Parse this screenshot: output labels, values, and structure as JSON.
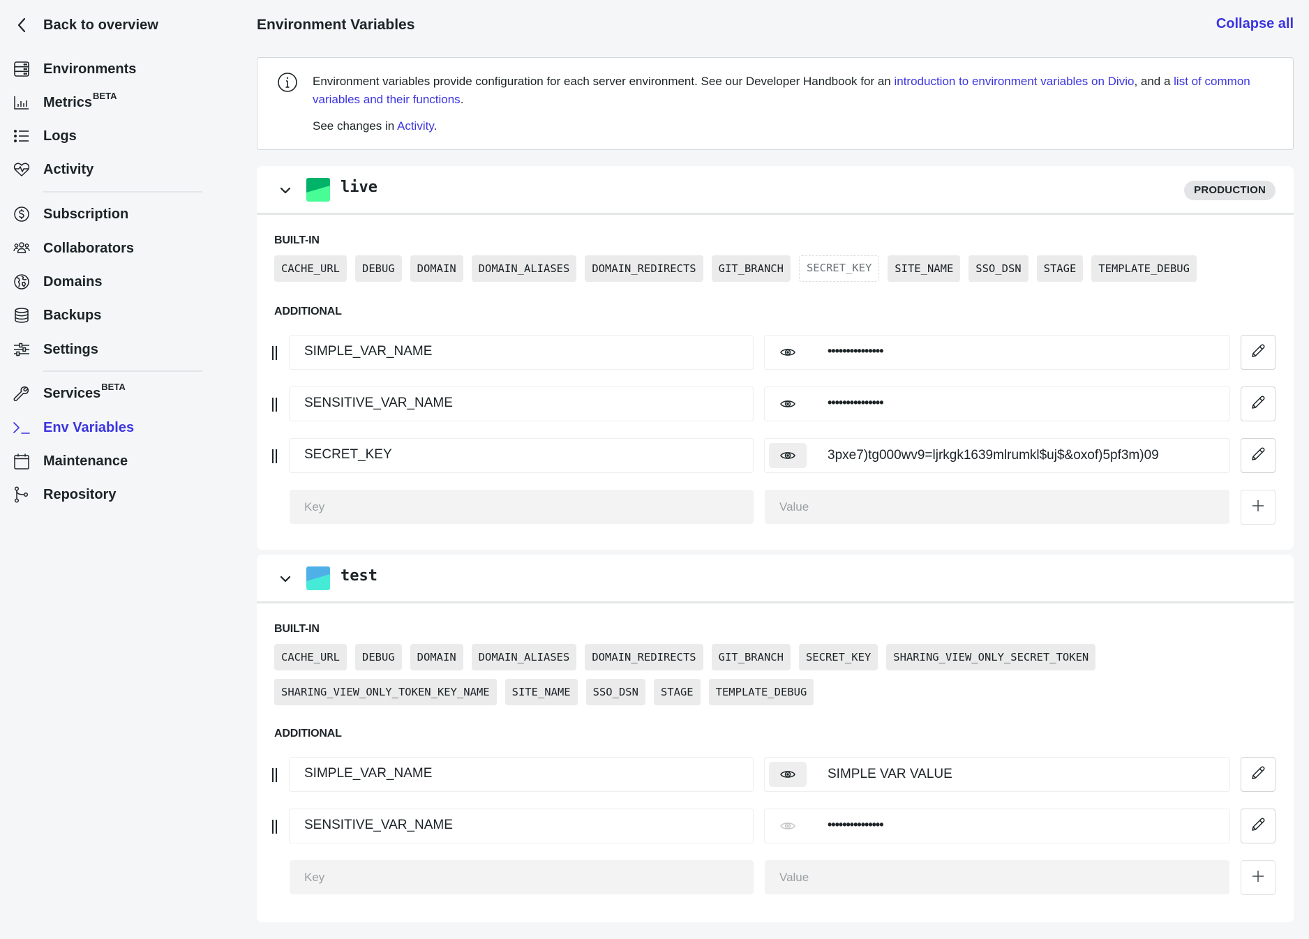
{
  "sidebar": {
    "back_label": "Back to overview",
    "items": [
      {
        "label": "Environments",
        "icon": "server-stack-icon"
      },
      {
        "label": "Metrics",
        "badge": "BETA",
        "icon": "bar-chart-icon"
      },
      {
        "label": "Logs",
        "icon": "list-icon"
      },
      {
        "label": "Activity",
        "icon": "heart-pulse-icon"
      },
      {
        "label": "Subscription",
        "icon": "dollar-circle-icon"
      },
      {
        "label": "Collaborators",
        "icon": "users-icon"
      },
      {
        "label": "Domains",
        "icon": "globe-icon"
      },
      {
        "label": "Backups",
        "icon": "database-icon"
      },
      {
        "label": "Settings",
        "icon": "sliders-icon"
      },
      {
        "label": "Services",
        "badge": "BETA",
        "icon": "wrench-icon"
      },
      {
        "label": "Env Variables",
        "icon": "terminal-icon",
        "active": true
      },
      {
        "label": "Maintenance",
        "icon": "calendar-icon"
      },
      {
        "label": "Repository",
        "icon": "git-branch-icon"
      }
    ]
  },
  "header": {
    "title": "Environment Variables",
    "collapse_all": "Collapse all"
  },
  "info": {
    "text_1": "Environment variables provide configuration for each server environment. See our Developer Handbook for an ",
    "link_1": "introduction to environment variables on Divio",
    "text_2": ", and a ",
    "link_2": "list of common variables and their functions",
    "text_3": ".",
    "text_4": "See changes in ",
    "link_3": "Activity",
    "text_5": "."
  },
  "colors": {
    "accent": "#3b35e0",
    "live_swatch_top": "#00b368",
    "live_swatch_bottom": "#48fc96",
    "test_swatch_top": "#4fb0e8",
    "test_swatch_bottom": "#46ebd8"
  },
  "environments": [
    {
      "name": "live",
      "badge": "PRODUCTION",
      "builtin_label": "BUILT-IN",
      "builtin": [
        "CACHE_URL",
        "DEBUG",
        "DOMAIN",
        "DOMAIN_ALIASES",
        "DOMAIN_REDIRECTS",
        "GIT_BRANCH",
        "SECRET_KEY",
        "SITE_NAME",
        "SSO_DSN",
        "STAGE",
        "TEMPLATE_DEBUG"
      ],
      "builtin_overridden": [
        "SECRET_KEY"
      ],
      "additional_label": "ADDITIONAL",
      "variables": [
        {
          "key": "SIMPLE_VAR_NAME",
          "value": "•••••••••••••••",
          "revealed": false
        },
        {
          "key": "SENSITIVE_VAR_NAME",
          "value": "•••••••••••••••",
          "revealed": false
        },
        {
          "key": "SECRET_KEY",
          "value": "3pxe7)tg000wv9=ljrkgk1639mlrumkl$uj$&oxof)5pf3m)09",
          "revealed": true
        }
      ],
      "new_key_placeholder": "Key",
      "new_value_placeholder": "Value"
    },
    {
      "name": "test",
      "badge": "",
      "builtin_label": "BUILT-IN",
      "builtin": [
        "CACHE_URL",
        "DEBUG",
        "DOMAIN",
        "DOMAIN_ALIASES",
        "DOMAIN_REDIRECTS",
        "GIT_BRANCH",
        "SECRET_KEY",
        "SHARING_VIEW_ONLY_SECRET_TOKEN",
        "SHARING_VIEW_ONLY_TOKEN_KEY_NAME",
        "SITE_NAME",
        "SSO_DSN",
        "STAGE",
        "TEMPLATE_DEBUG"
      ],
      "builtin_overridden": [],
      "additional_label": "ADDITIONAL",
      "variables": [
        {
          "key": "SIMPLE_VAR_NAME",
          "value": "SIMPLE VAR VALUE",
          "revealed": true
        },
        {
          "key": "SENSITIVE_VAR_NAME",
          "value": "•••••••••••••••",
          "revealed": false,
          "sensitive": true
        }
      ],
      "new_key_placeholder": "Key",
      "new_value_placeholder": "Value"
    }
  ]
}
